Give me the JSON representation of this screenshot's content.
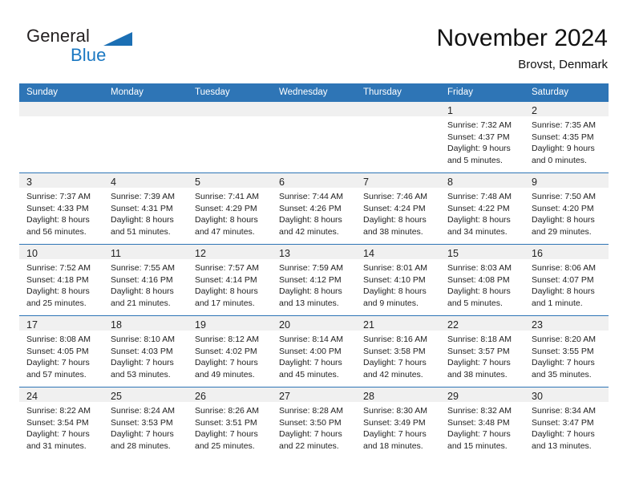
{
  "brand": {
    "word1": "General",
    "word2": "Blue",
    "triangle_color": "#1b6fb4"
  },
  "header": {
    "title": "November 2024",
    "location": "Brovst, Denmark"
  },
  "theme": {
    "header_blue": "#2e75b6",
    "day_band_gray": "#f0f0f0",
    "text": "#222222",
    "brand_blue": "#1b78c2"
  },
  "weekdays": [
    "Sunday",
    "Monday",
    "Tuesday",
    "Wednesday",
    "Thursday",
    "Friday",
    "Saturday"
  ],
  "weeks": [
    [
      {
        "empty": true
      },
      {
        "empty": true
      },
      {
        "empty": true
      },
      {
        "empty": true
      },
      {
        "empty": true
      },
      {
        "day": "1",
        "sunrise": "Sunrise: 7:32 AM",
        "sunset": "Sunset: 4:37 PM",
        "daylight": "Daylight: 9 hours and 5 minutes."
      },
      {
        "day": "2",
        "sunrise": "Sunrise: 7:35 AM",
        "sunset": "Sunset: 4:35 PM",
        "daylight": "Daylight: 9 hours and 0 minutes."
      }
    ],
    [
      {
        "day": "3",
        "sunrise": "Sunrise: 7:37 AM",
        "sunset": "Sunset: 4:33 PM",
        "daylight": "Daylight: 8 hours and 56 minutes."
      },
      {
        "day": "4",
        "sunrise": "Sunrise: 7:39 AM",
        "sunset": "Sunset: 4:31 PM",
        "daylight": "Daylight: 8 hours and 51 minutes."
      },
      {
        "day": "5",
        "sunrise": "Sunrise: 7:41 AM",
        "sunset": "Sunset: 4:29 PM",
        "daylight": "Daylight: 8 hours and 47 minutes."
      },
      {
        "day": "6",
        "sunrise": "Sunrise: 7:44 AM",
        "sunset": "Sunset: 4:26 PM",
        "daylight": "Daylight: 8 hours and 42 minutes."
      },
      {
        "day": "7",
        "sunrise": "Sunrise: 7:46 AM",
        "sunset": "Sunset: 4:24 PM",
        "daylight": "Daylight: 8 hours and 38 minutes."
      },
      {
        "day": "8",
        "sunrise": "Sunrise: 7:48 AM",
        "sunset": "Sunset: 4:22 PM",
        "daylight": "Daylight: 8 hours and 34 minutes."
      },
      {
        "day": "9",
        "sunrise": "Sunrise: 7:50 AM",
        "sunset": "Sunset: 4:20 PM",
        "daylight": "Daylight: 8 hours and 29 minutes."
      }
    ],
    [
      {
        "day": "10",
        "sunrise": "Sunrise: 7:52 AM",
        "sunset": "Sunset: 4:18 PM",
        "daylight": "Daylight: 8 hours and 25 minutes."
      },
      {
        "day": "11",
        "sunrise": "Sunrise: 7:55 AM",
        "sunset": "Sunset: 4:16 PM",
        "daylight": "Daylight: 8 hours and 21 minutes."
      },
      {
        "day": "12",
        "sunrise": "Sunrise: 7:57 AM",
        "sunset": "Sunset: 4:14 PM",
        "daylight": "Daylight: 8 hours and 17 minutes."
      },
      {
        "day": "13",
        "sunrise": "Sunrise: 7:59 AM",
        "sunset": "Sunset: 4:12 PM",
        "daylight": "Daylight: 8 hours and 13 minutes."
      },
      {
        "day": "14",
        "sunrise": "Sunrise: 8:01 AM",
        "sunset": "Sunset: 4:10 PM",
        "daylight": "Daylight: 8 hours and 9 minutes."
      },
      {
        "day": "15",
        "sunrise": "Sunrise: 8:03 AM",
        "sunset": "Sunset: 4:08 PM",
        "daylight": "Daylight: 8 hours and 5 minutes."
      },
      {
        "day": "16",
        "sunrise": "Sunrise: 8:06 AM",
        "sunset": "Sunset: 4:07 PM",
        "daylight": "Daylight: 8 hours and 1 minute."
      }
    ],
    [
      {
        "day": "17",
        "sunrise": "Sunrise: 8:08 AM",
        "sunset": "Sunset: 4:05 PM",
        "daylight": "Daylight: 7 hours and 57 minutes."
      },
      {
        "day": "18",
        "sunrise": "Sunrise: 8:10 AM",
        "sunset": "Sunset: 4:03 PM",
        "daylight": "Daylight: 7 hours and 53 minutes."
      },
      {
        "day": "19",
        "sunrise": "Sunrise: 8:12 AM",
        "sunset": "Sunset: 4:02 PM",
        "daylight": "Daylight: 7 hours and 49 minutes."
      },
      {
        "day": "20",
        "sunrise": "Sunrise: 8:14 AM",
        "sunset": "Sunset: 4:00 PM",
        "daylight": "Daylight: 7 hours and 45 minutes."
      },
      {
        "day": "21",
        "sunrise": "Sunrise: 8:16 AM",
        "sunset": "Sunset: 3:58 PM",
        "daylight": "Daylight: 7 hours and 42 minutes."
      },
      {
        "day": "22",
        "sunrise": "Sunrise: 8:18 AM",
        "sunset": "Sunset: 3:57 PM",
        "daylight": "Daylight: 7 hours and 38 minutes."
      },
      {
        "day": "23",
        "sunrise": "Sunrise: 8:20 AM",
        "sunset": "Sunset: 3:55 PM",
        "daylight": "Daylight: 7 hours and 35 minutes."
      }
    ],
    [
      {
        "day": "24",
        "sunrise": "Sunrise: 8:22 AM",
        "sunset": "Sunset: 3:54 PM",
        "daylight": "Daylight: 7 hours and 31 minutes."
      },
      {
        "day": "25",
        "sunrise": "Sunrise: 8:24 AM",
        "sunset": "Sunset: 3:53 PM",
        "daylight": "Daylight: 7 hours and 28 minutes."
      },
      {
        "day": "26",
        "sunrise": "Sunrise: 8:26 AM",
        "sunset": "Sunset: 3:51 PM",
        "daylight": "Daylight: 7 hours and 25 minutes."
      },
      {
        "day": "27",
        "sunrise": "Sunrise: 8:28 AM",
        "sunset": "Sunset: 3:50 PM",
        "daylight": "Daylight: 7 hours and 22 minutes."
      },
      {
        "day": "28",
        "sunrise": "Sunrise: 8:30 AM",
        "sunset": "Sunset: 3:49 PM",
        "daylight": "Daylight: 7 hours and 18 minutes."
      },
      {
        "day": "29",
        "sunrise": "Sunrise: 8:32 AM",
        "sunset": "Sunset: 3:48 PM",
        "daylight": "Daylight: 7 hours and 15 minutes."
      },
      {
        "day": "30",
        "sunrise": "Sunrise: 8:34 AM",
        "sunset": "Sunset: 3:47 PM",
        "daylight": "Daylight: 7 hours and 13 minutes."
      }
    ]
  ]
}
